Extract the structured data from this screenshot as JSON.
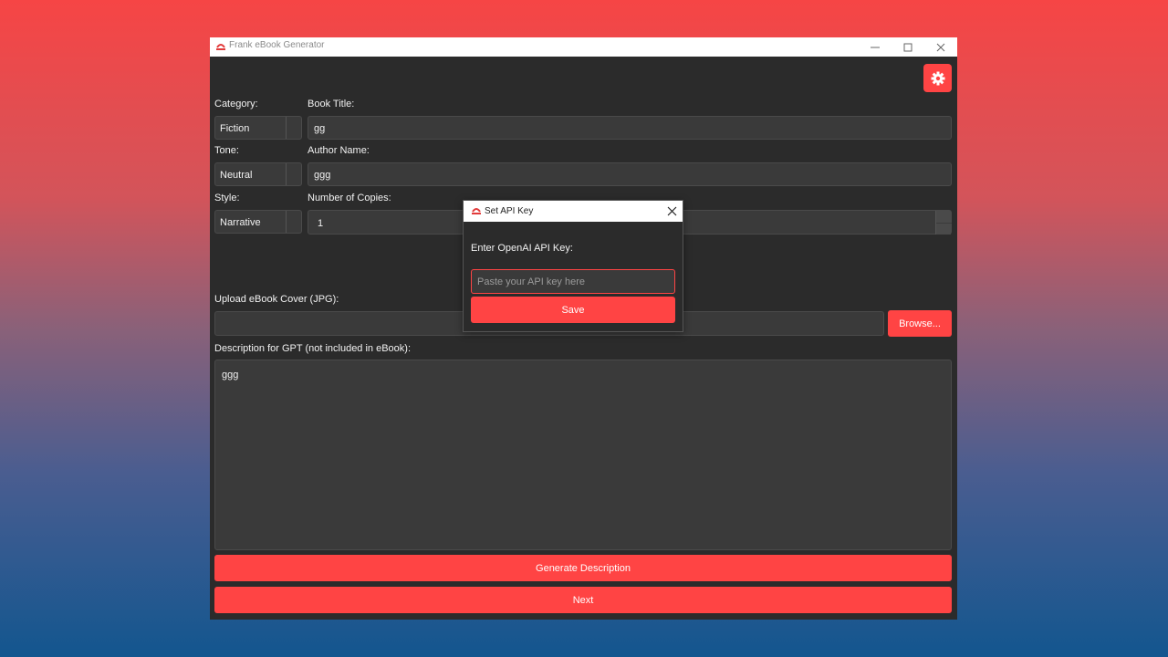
{
  "window": {
    "title": "Frank eBook Generator"
  },
  "form": {
    "category_label": "Category:",
    "category_value": "Fiction",
    "tone_label": "Tone:",
    "tone_value": "Neutral",
    "style_label": "Style:",
    "style_value": "Narrative",
    "book_title_label": "Book Title:",
    "book_title_value": "gg",
    "author_label": "Author Name:",
    "author_value": "ggg",
    "copies_label": "Number of Copies:",
    "copies_value": "1",
    "cover_label": "Upload eBook Cover (JPG):",
    "cover_value": "",
    "browse_label": "Browse...",
    "description_label": "Description for GPT (not included in eBook):",
    "description_value": "ggg",
    "generate_label": "Generate Description",
    "next_label": "Next"
  },
  "dialog": {
    "title": "Set API Key",
    "prompt": "Enter OpenAI API Key:",
    "placeholder": "Paste your API key here",
    "value": "",
    "save_label": "Save"
  },
  "icons": {
    "settings": "gear-icon",
    "app": "app-logo-icon",
    "minimize": "minimize-icon",
    "maximize": "maximize-icon",
    "close": "close-icon"
  },
  "colors": {
    "accent": "#ff4444",
    "window_bg": "#2b2b2b",
    "field_bg": "#3a3a3a"
  }
}
